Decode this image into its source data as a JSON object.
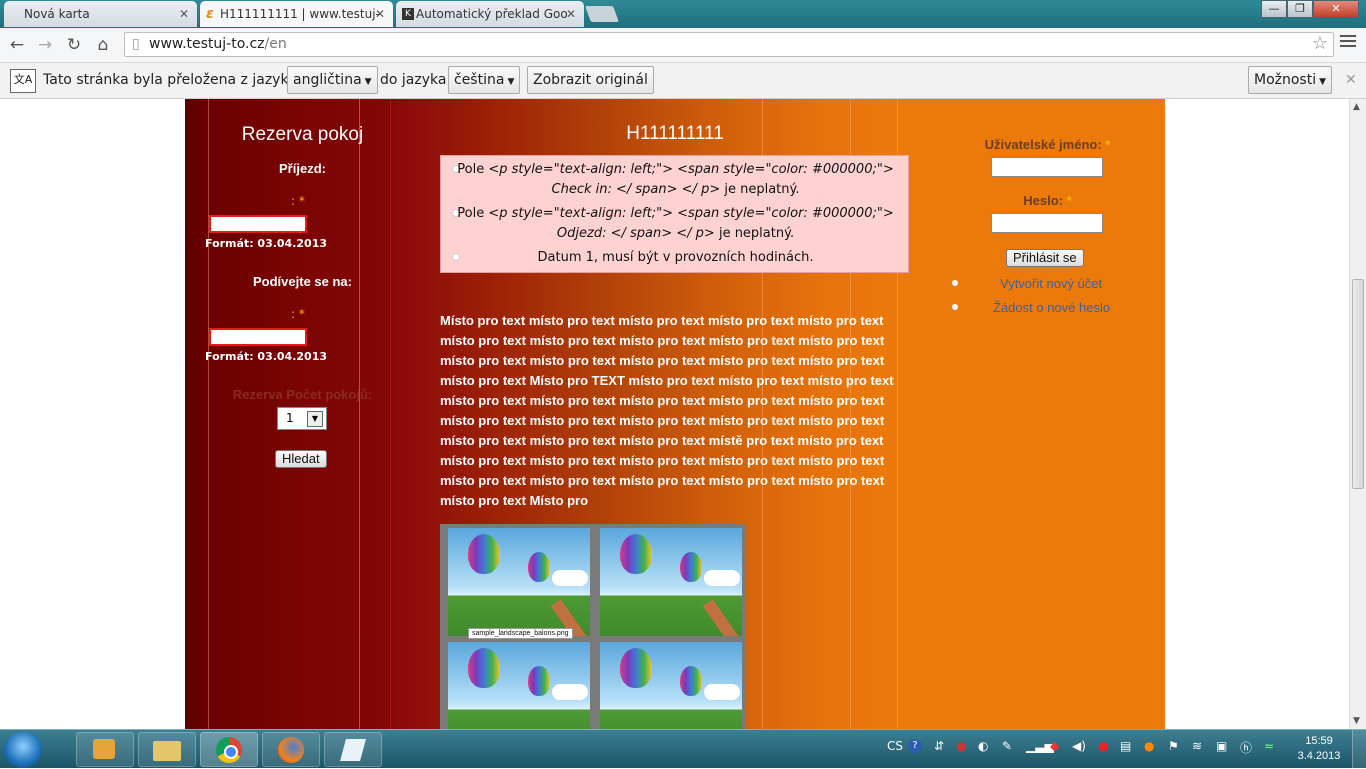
{
  "browser": {
    "tabs": [
      {
        "title": "Nová karta",
        "icon": "blank-page-icon"
      },
      {
        "title": "H111111111 | www.testuj-",
        "icon": "site-favicon-icon"
      },
      {
        "title": "Automatický překlad Goo",
        "icon": "k-favicon-icon"
      }
    ],
    "address": {
      "host": "www.testuj-to.cz",
      "path": "/en"
    },
    "window_buttons": [
      "—",
      "❐",
      "✕"
    ]
  },
  "translate_bar": {
    "message": "Tato stránka byla přeložena z jazyka",
    "from_lang": "angličtina",
    "to_label": "do jazyka",
    "to_lang": "čeština",
    "show_original": "Zobrazit originál",
    "options": "Možnosti",
    "close": "✕"
  },
  "left": {
    "title": "Rezerva pokoj",
    "arrival_label": "Příjezd:",
    "arrival_req": ": *",
    "arrival_format": "Formát: 03.04.2013",
    "departure_label": "Podívejte se na:",
    "departure_req": ": *",
    "departure_format": "Formát: 03.04.2013",
    "rooms_label": "Rezerva Počet pokojů:",
    "rooms_value": "1",
    "search_button": "Hledat"
  },
  "main": {
    "title": "H111111111",
    "errors": [
      {
        "prefix": "Pole",
        "code1": "<p style=\"text-align: left;\"> <span style=\"color: #000000;\">",
        "code2": "Check in: </ span> </ p>",
        "suffix": "je neplatný."
      },
      {
        "prefix": "Pole",
        "code1": "<p style=\"text-align: left;\"> <span style=\"color: #000000;\">",
        "code2": "Odjezd: </ span> </ p>",
        "suffix": "je neplatný."
      },
      {
        "text": "Datum 1, musí být v provozních hodinách."
      }
    ],
    "body_lines": [
      "Místo pro text místo pro text místo pro text místo pro text místo pro text",
      "místo pro text místo pro text místo pro text místo pro text místo pro text",
      "místo pro text místo pro text místo pro text místo pro text místo pro text",
      "místo pro text Místo pro TEXT místo pro text místo pro text místo pro text",
      "místo pro text místo pro text místo pro text místo pro text místo pro text",
      "místo pro text místo pro text místo pro text místo pro text místo pro text",
      "místo pro text místo pro text místo pro text místě pro text místo pro text",
      "místo pro text místo pro text místo pro text místo pro text místo pro text",
      "místo pro text místo pro text místo pro text místo pro text místo pro text",
      "místo pro text Místo pro"
    ],
    "image_caption": "sample_landscape_balons.png"
  },
  "right": {
    "username_label": "Uživatelské jméno:",
    "password_label": "Heslo:",
    "required_mark": "*",
    "login_button": "Přihlásit se",
    "links": [
      "Vytvořit nový účet",
      "Žádost o nové heslo"
    ]
  },
  "taskbar": {
    "lang": "CS",
    "time": "15:59",
    "date": "3.4.2013",
    "apps": [
      "media-player-icon",
      "explorer-icon",
      "chrome-icon",
      "firefox-icon",
      "notepad-icon"
    ]
  },
  "colors": {
    "error_bg": "#ffd2d2",
    "required": "#f7b300",
    "link": "#3f5f9e"
  }
}
